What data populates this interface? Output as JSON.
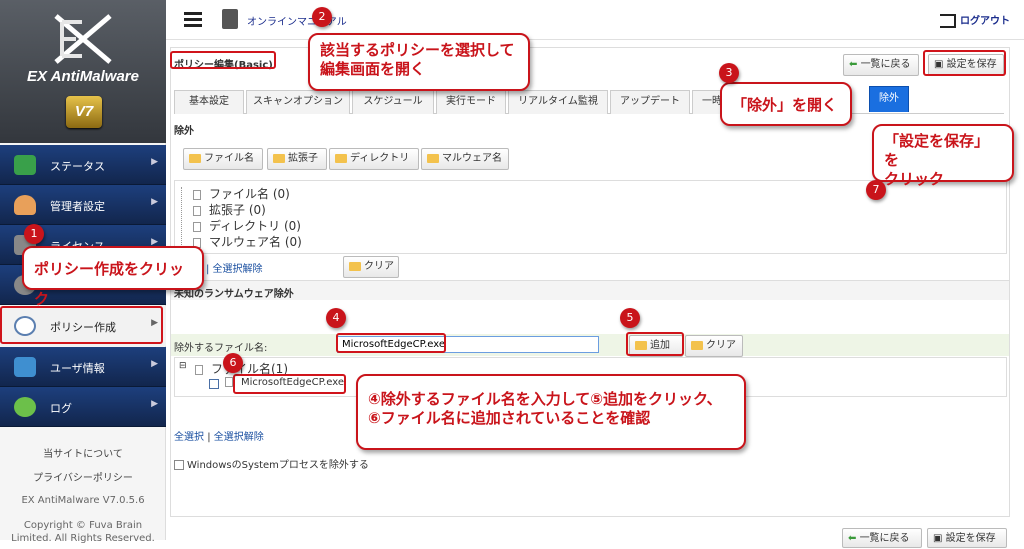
{
  "sidebar": {
    "logo_name": "EX AntiMalware",
    "logo_version": "V7",
    "items": [
      {
        "label": "ステータス",
        "color": "#39a04a"
      },
      {
        "label": "管理者設定",
        "color": "#e8a05a"
      },
      {
        "label": "ライセンス",
        "color": "#888888"
      },
      {
        "label": "",
        "color": "#888888"
      },
      {
        "label": "ポリシー作成",
        "color": "#5b7fb0"
      },
      {
        "label": "ユーザ情報",
        "color": "#3f8fd0"
      },
      {
        "label": "ログ",
        "color": "#6cc04a"
      }
    ],
    "footer": {
      "about": "当サイトについて",
      "privacy": "プライバシーポリシー",
      "version": "EX AntiMalware V7.0.5.6",
      "copyright1": "Copyright © Fuva Brain",
      "copyright2": "Limited. All Rights Reserved."
    }
  },
  "header": {
    "manual_link": "オンラインマニュアル",
    "logout": "ログアウト"
  },
  "panel": {
    "title": "ポリシー編集(Basic)",
    "back_button": "一覧に戻る",
    "save_button": "設定を保存",
    "tabs": [
      "基本設定",
      "スキャンオプション",
      "スケジュール",
      "実行モード",
      "リアルタイム監視",
      "アップデート",
      "一時",
      "除外"
    ],
    "section_exclude": "除外",
    "type_buttons": [
      "ファイル名",
      "拡張子",
      "ディレクトリ",
      "マルウェア名"
    ],
    "tree_items": [
      "ファイル名 (0)",
      "拡張子 (0)",
      "ディレクトリ (0)",
      "マルウェア名 (0)"
    ],
    "select_none_short": "| 全選択解除",
    "clear_button": "クリア",
    "section_ransom": "未知のランサムウェア除外",
    "file_input_label": "除外するファイル名:",
    "file_input_value": "MicrosoftEdgeCP.exe",
    "add_button": "追加",
    "ransom_tree_root": "ファイル名(1)",
    "ransom_tree_child": "MicrosoftEdgeCP.exe",
    "select_all": "全選択",
    "separator": "|",
    "select_none": "全選択解除",
    "system_checkbox": "WindowsのSystemプロセスを除外する"
  },
  "annotations": {
    "n1": "1",
    "n2": "2",
    "n3": "3",
    "n4": "4",
    "n5": "5",
    "n6": "6",
    "n7": "7",
    "c_policy": "ポリシー作成をクリック",
    "c_select": "該当するポリシーを選択して\n編集画面を開く",
    "c_exclude": "「除外」を開く",
    "c_save": "「設定を保存」を\nクリック",
    "c_add": "④除外するファイル名を入力して⑤追加をクリック、\n⑥ファイル名に追加されていることを確認"
  }
}
